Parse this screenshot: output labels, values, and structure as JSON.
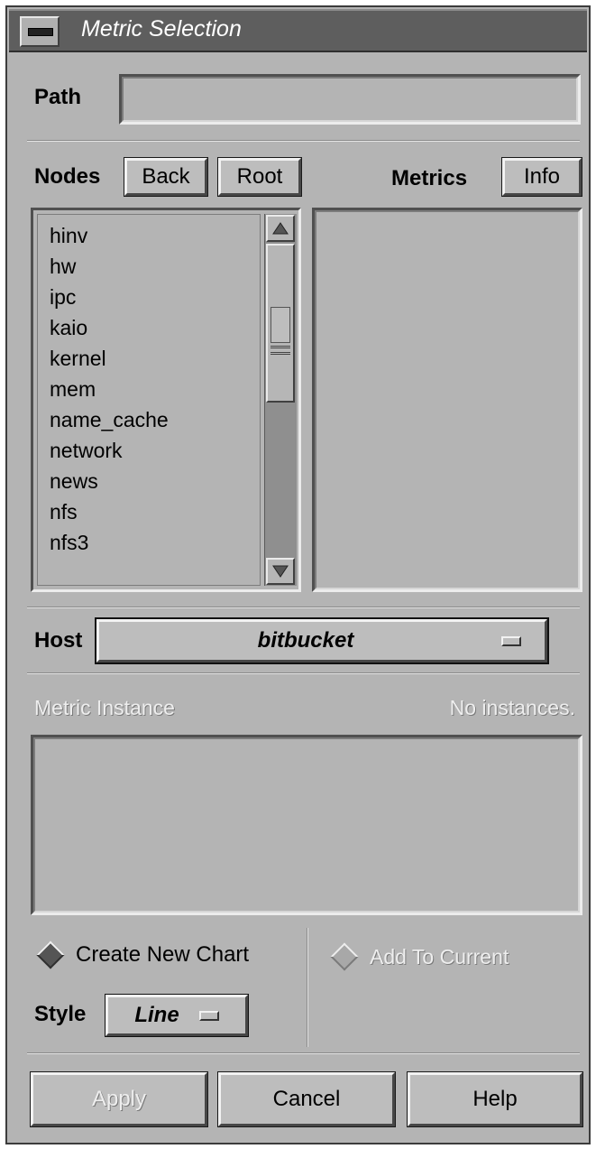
{
  "window": {
    "title": "Metric Selection"
  },
  "path": {
    "label": "Path",
    "value": ""
  },
  "nodes": {
    "label": "Nodes",
    "back_label": "Back",
    "root_label": "Root",
    "items": [
      "hinv",
      "hw",
      "ipc",
      "kaio",
      "kernel",
      "mem",
      "name_cache",
      "network",
      "news",
      "nfs",
      "nfs3"
    ]
  },
  "metrics": {
    "label": "Metrics",
    "info_label": "Info",
    "items": []
  },
  "host": {
    "label": "Host",
    "value": "bitbucket"
  },
  "instance": {
    "label": "Metric Instance",
    "status": "No instances."
  },
  "options": {
    "create_new_chart": "Create New Chart",
    "add_to_current": "Add To Current"
  },
  "style": {
    "label": "Style",
    "value": "Line"
  },
  "actions": {
    "apply": "Apply",
    "cancel": "Cancel",
    "help": "Help"
  },
  "colors": {
    "panel": "#b4b4b4",
    "titlebar": "#5e5e5e",
    "title_text": "#ffffff"
  }
}
